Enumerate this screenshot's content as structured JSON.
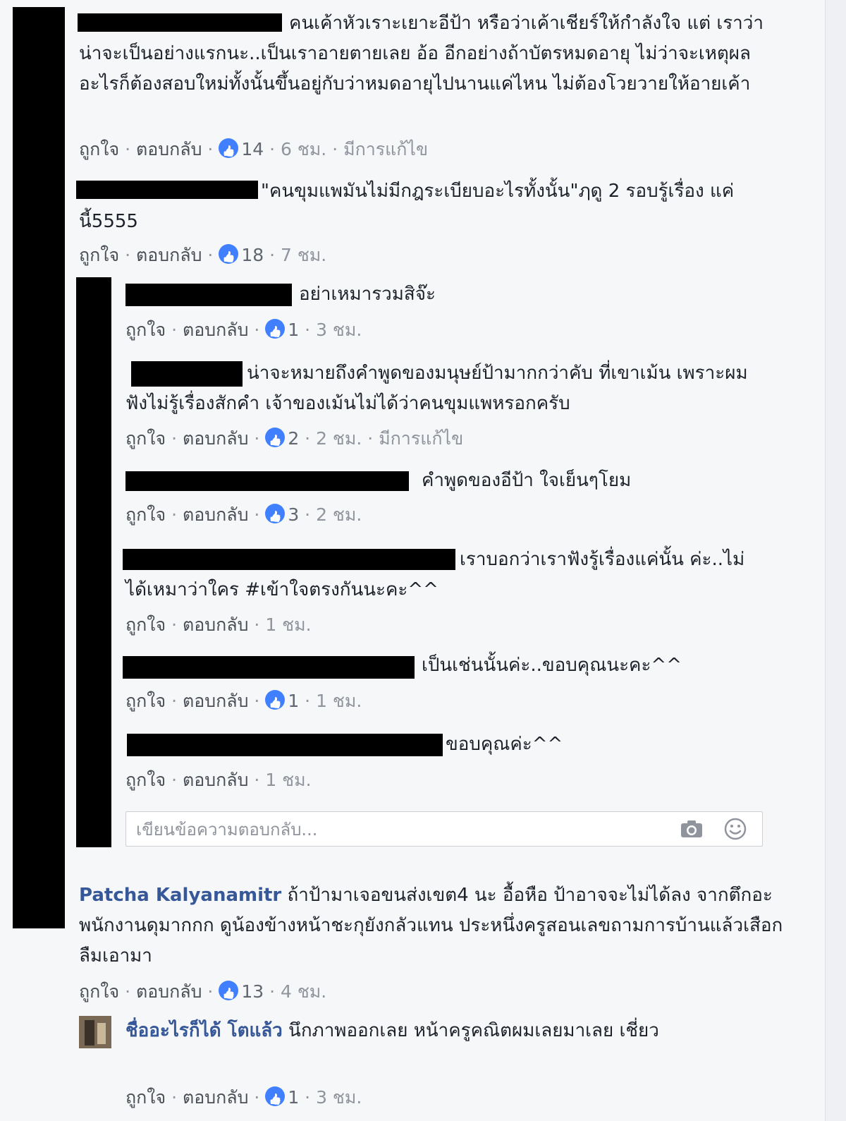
{
  "actions": {
    "like": "ถูกใจ",
    "reply": "ตอบกลับ",
    "separator": "·"
  },
  "comments": [
    {
      "text_line1": "คนเค้าหัวเราะเยาะอีป้า หรือว่าเค้าเชียร์ให้กำลังใจ แต่",
      "text_rest": "เราว่าน่าจะเป็นอย่างแรกนะ..เป็นเราอายตายเลย อ้อ อีกอย่างถ้าบัตรหมดอายุ ไม่ว่าจะเหตุผลอะไรก็ต้องสอบใหม่ทั้งนั้นขึ้นอยู่กับว่าหมดอายุไปนานแค่ไหน ไม่ต้องโวยวายให้อายเค้า",
      "likes": "14",
      "time": "6 ชม.",
      "edited": "มีการแก้ไข"
    },
    {
      "text_line1": "\"คนขุมแพมันไม่มีกฎระเบียบอะไรทั้งนั้น\"ฦดู 2 รอบรู้เรื่อง",
      "text_rest": "แค่นี้5555",
      "likes": "18",
      "time": "7 ชม."
    }
  ],
  "replies": [
    {
      "text": "อย่าเหมารวมสิจ๊ะ",
      "likes": "1",
      "time": "3 ชม."
    },
    {
      "text_line1": "น่าจะหมายถึงคำพูดของมนุษย์ป้ามากกว่าคับ ที่เขาเม้น",
      "text_rest": "เพราะผมฟังไม่รู้เรื่องสักคำ เจ้าของเม้นไม่ได้ว่าคนขุมแพหรอกครับ",
      "likes": "2",
      "time": "2 ชม.",
      "edited": "มีการแก้ไข"
    },
    {
      "text": "คำพูดของอีป้า ใจเย็นๆโยม",
      "likes": "3",
      "time": "2 ชม."
    },
    {
      "text_line1": "เราบอกว่าเราฟังรู้เรื่องแค่นั้น",
      "text_rest": "ค่ะ..ไม่ได้เหมาว่าใคร #เข้าใจตรงกันนะคะ^^",
      "time": "1 ชม."
    },
    {
      "text": "เป็นเช่นนั้นค่ะ..ขอบคุณนะคะ^^",
      "likes": "1",
      "time": "1 ชม."
    },
    {
      "text": "ขอบคุณค่ะ^^",
      "time": "1 ชม."
    }
  ],
  "reply_input": {
    "placeholder": "เขียนข้อความตอบกลับ..."
  },
  "comment3": {
    "author": "Patcha Kalyanamitr",
    "text_line1": " ถ้าป้ามาเจอขนส่งเขต4 นะ อื้อหือ ป้าอาจจะไม่ได้ลง",
    "text_rest": "จากตึกอะ พนักงานดุมากกก ดูน้องข้างหน้าชะกุยังกลัวแทน ประหนึ่งครูสอนเลขถามการบ้านแล้วเสือกลืมเอามา",
    "likes": "13",
    "time": "4 ชม."
  },
  "reply4": {
    "author": "ชื่ออะไรก็ได้ โตแล้ว",
    "text_line1": " นึกภาพออกเลย หน้าครูคณิตผมเลยมาเลย",
    "text_rest": "เชี่ยว",
    "likes": "1",
    "time": "3 ชม."
  }
}
